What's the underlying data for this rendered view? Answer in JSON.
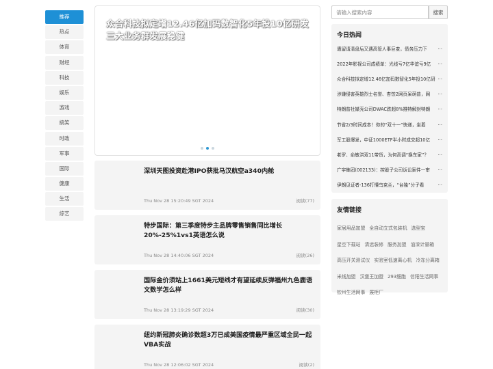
{
  "nav": {
    "items": [
      "推荐",
      "热点",
      "体育",
      "财经",
      "科技",
      "娱乐",
      "游戏",
      "搞笑",
      "时政",
      "军事",
      "国际",
      "健康",
      "生活",
      "综艺"
    ]
  },
  "banner": {
    "title": "众合科技拟定增12.46亿加码数智化5年投10亿研发三大业务群发展稳健"
  },
  "articles": [
    {
      "title": "深圳天图投资赴港IPO获批马汉航空a340内舱",
      "date": "Thu Nov 28 15:20:49 SGT 2024",
      "reads": "阅读(77)"
    },
    {
      "title": "特步国际：第三季度特步主品牌零售销售同比增长20%-25%1vs1英语怎么说",
      "date": "Thu Nov 28 14:40:06 SGT 2024",
      "reads": "阅读(26)"
    },
    {
      "title": "国际金价须站上1661美元短线才有望延续反弹福州九色鹿语文数学怎么样",
      "date": "Thu Nov 28 13:19:29 SGT 2024",
      "reads": "阅读(30)"
    },
    {
      "title": "纽约新冠肺炎确诊数超3万已成美国疫情最严重区域全民一起VBA实战",
      "date": "Thu Nov 28 12:06:02 SGT 2024",
      "reads": "阅读(2)"
    }
  ],
  "search": {
    "placeholder": "请输入搜索内容",
    "button": "搜索"
  },
  "hot": {
    "title": "今日热闻",
    "items": [
      "遭留请清盘后又遇高管人事巨变，债务压力下",
      "2022年影视公司成绩单：光线亏7亿华谊亏9亿",
      "众合科技拟定增12.46亿加码数智化5年投10亿研",
      "涉嫌侵害英雄烈士名誉、杏饺2网页呆萌普，网",
      "特朗普社媒壳公司DWAC跌超8%推特解封特朗",
      "节省2/3时间成本！你的“双十一”快递，坐着",
      "军工股爆发，中证1000ETF半小时成交超10亿",
      "老罗、俞敏洪双11带货，为何高调“换东家”？",
      "广宇集团(002133)：控股子公司诉讼案件一审",
      "伊朗见证者-136打懵乌克兰，“台独”分子看"
    ]
  },
  "links": {
    "title": "友情链接",
    "items": [
      "家居用品加盟",
      "全自动立式包装机",
      "选型宝",
      "星空下载站",
      "清远装修",
      "服务加盟",
      "油漆计量箱",
      "高压开关测试仪",
      "实验室低速离心机",
      "冷冻分离箱",
      "米线加盟",
      "汉堡王加盟",
      "293细胞",
      "信阳生活网事",
      "钦州生活网事",
      "展柜厂"
    ]
  }
}
